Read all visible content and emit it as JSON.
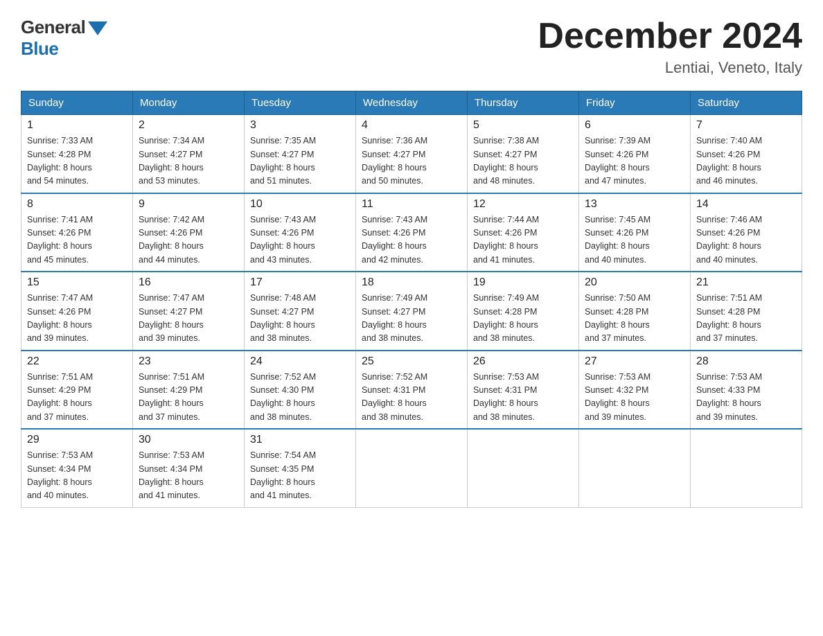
{
  "header": {
    "logo_general": "General",
    "logo_blue": "Blue",
    "month_title": "December 2024",
    "location": "Lentiai, Veneto, Italy"
  },
  "weekdays": [
    "Sunday",
    "Monday",
    "Tuesday",
    "Wednesday",
    "Thursday",
    "Friday",
    "Saturday"
  ],
  "weeks": [
    [
      {
        "day": "1",
        "sunrise": "7:33 AM",
        "sunset": "4:28 PM",
        "daylight": "8 hours and 54 minutes."
      },
      {
        "day": "2",
        "sunrise": "7:34 AM",
        "sunset": "4:27 PM",
        "daylight": "8 hours and 53 minutes."
      },
      {
        "day": "3",
        "sunrise": "7:35 AM",
        "sunset": "4:27 PM",
        "daylight": "8 hours and 51 minutes."
      },
      {
        "day": "4",
        "sunrise": "7:36 AM",
        "sunset": "4:27 PM",
        "daylight": "8 hours and 50 minutes."
      },
      {
        "day": "5",
        "sunrise": "7:38 AM",
        "sunset": "4:27 PM",
        "daylight": "8 hours and 48 minutes."
      },
      {
        "day": "6",
        "sunrise": "7:39 AM",
        "sunset": "4:26 PM",
        "daylight": "8 hours and 47 minutes."
      },
      {
        "day": "7",
        "sunrise": "7:40 AM",
        "sunset": "4:26 PM",
        "daylight": "8 hours and 46 minutes."
      }
    ],
    [
      {
        "day": "8",
        "sunrise": "7:41 AM",
        "sunset": "4:26 PM",
        "daylight": "8 hours and 45 minutes."
      },
      {
        "day": "9",
        "sunrise": "7:42 AM",
        "sunset": "4:26 PM",
        "daylight": "8 hours and 44 minutes."
      },
      {
        "day": "10",
        "sunrise": "7:43 AM",
        "sunset": "4:26 PM",
        "daylight": "8 hours and 43 minutes."
      },
      {
        "day": "11",
        "sunrise": "7:43 AM",
        "sunset": "4:26 PM",
        "daylight": "8 hours and 42 minutes."
      },
      {
        "day": "12",
        "sunrise": "7:44 AM",
        "sunset": "4:26 PM",
        "daylight": "8 hours and 41 minutes."
      },
      {
        "day": "13",
        "sunrise": "7:45 AM",
        "sunset": "4:26 PM",
        "daylight": "8 hours and 40 minutes."
      },
      {
        "day": "14",
        "sunrise": "7:46 AM",
        "sunset": "4:26 PM",
        "daylight": "8 hours and 40 minutes."
      }
    ],
    [
      {
        "day": "15",
        "sunrise": "7:47 AM",
        "sunset": "4:26 PM",
        "daylight": "8 hours and 39 minutes."
      },
      {
        "day": "16",
        "sunrise": "7:47 AM",
        "sunset": "4:27 PM",
        "daylight": "8 hours and 39 minutes."
      },
      {
        "day": "17",
        "sunrise": "7:48 AM",
        "sunset": "4:27 PM",
        "daylight": "8 hours and 38 minutes."
      },
      {
        "day": "18",
        "sunrise": "7:49 AM",
        "sunset": "4:27 PM",
        "daylight": "8 hours and 38 minutes."
      },
      {
        "day": "19",
        "sunrise": "7:49 AM",
        "sunset": "4:28 PM",
        "daylight": "8 hours and 38 minutes."
      },
      {
        "day": "20",
        "sunrise": "7:50 AM",
        "sunset": "4:28 PM",
        "daylight": "8 hours and 37 minutes."
      },
      {
        "day": "21",
        "sunrise": "7:51 AM",
        "sunset": "4:28 PM",
        "daylight": "8 hours and 37 minutes."
      }
    ],
    [
      {
        "day": "22",
        "sunrise": "7:51 AM",
        "sunset": "4:29 PM",
        "daylight": "8 hours and 37 minutes."
      },
      {
        "day": "23",
        "sunrise": "7:51 AM",
        "sunset": "4:29 PM",
        "daylight": "8 hours and 37 minutes."
      },
      {
        "day": "24",
        "sunrise": "7:52 AM",
        "sunset": "4:30 PM",
        "daylight": "8 hours and 38 minutes."
      },
      {
        "day": "25",
        "sunrise": "7:52 AM",
        "sunset": "4:31 PM",
        "daylight": "8 hours and 38 minutes."
      },
      {
        "day": "26",
        "sunrise": "7:53 AM",
        "sunset": "4:31 PM",
        "daylight": "8 hours and 38 minutes."
      },
      {
        "day": "27",
        "sunrise": "7:53 AM",
        "sunset": "4:32 PM",
        "daylight": "8 hours and 39 minutes."
      },
      {
        "day": "28",
        "sunrise": "7:53 AM",
        "sunset": "4:33 PM",
        "daylight": "8 hours and 39 minutes."
      }
    ],
    [
      {
        "day": "29",
        "sunrise": "7:53 AM",
        "sunset": "4:34 PM",
        "daylight": "8 hours and 40 minutes."
      },
      {
        "day": "30",
        "sunrise": "7:53 AM",
        "sunset": "4:34 PM",
        "daylight": "8 hours and 41 minutes."
      },
      {
        "day": "31",
        "sunrise": "7:54 AM",
        "sunset": "4:35 PM",
        "daylight": "8 hours and 41 minutes."
      },
      null,
      null,
      null,
      null
    ]
  ],
  "labels": {
    "sunrise": "Sunrise:",
    "sunset": "Sunset:",
    "daylight": "Daylight:"
  }
}
